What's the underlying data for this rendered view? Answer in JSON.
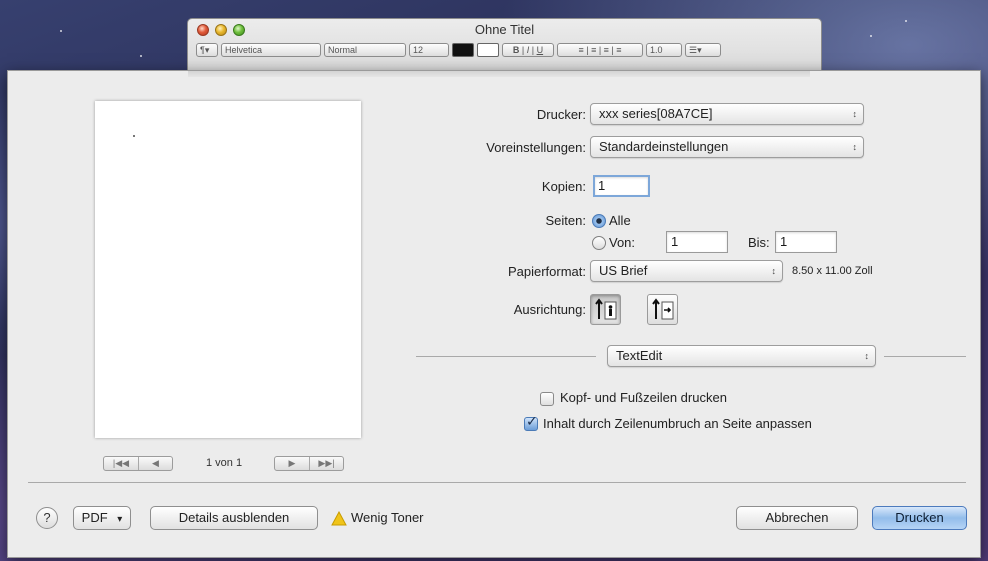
{
  "document": {
    "title": "Ohne Titel",
    "toolbar": {
      "paragraph": "¶▾",
      "font": "Helvetica",
      "style": "Normal",
      "size": "12",
      "line_spacing": "1.0",
      "list": "☰▾"
    }
  },
  "preview": {
    "page_indicator": "1 von 1",
    "first_page": "|◀◀",
    "prev_page": "◀",
    "next_page": "▶",
    "last_page": "▶▶|"
  },
  "printer": {
    "label": "Drucker:",
    "value": "xxx series[08A7CE]"
  },
  "presets": {
    "label": "Voreinstellungen:",
    "value": "Standardeinstellungen"
  },
  "copies": {
    "label": "Kopien:",
    "value": "1"
  },
  "pages": {
    "label": "Seiten:",
    "all_label": "Alle",
    "from_label": "Von:",
    "from_value": "1",
    "to_label": "Bis:",
    "to_value": "1",
    "selected": "Alle"
  },
  "paper": {
    "label": "Papierformat:",
    "value": "US Brief",
    "size_text": "8.50 x 11.00 Zoll"
  },
  "orientation": {
    "label": "Ausrichtung:",
    "selected": "portrait"
  },
  "app_section": {
    "value": "TextEdit"
  },
  "options": {
    "header_footer": {
      "label": "Kopf- und Fußzeilen drucken",
      "checked": false
    },
    "rewrap": {
      "label": "Inhalt durch Zeilenumbruch an Seite anpassen",
      "checked": true
    }
  },
  "footer": {
    "help": "?",
    "pdf": "PDF",
    "pdf_arrow": "▾",
    "details": "Details ausblenden",
    "warning": "Wenig Toner",
    "cancel": "Abbrechen",
    "print": "Drucken"
  },
  "colors": {
    "accent": "#6c9ed8",
    "default_button": "#93bdea",
    "warning": "#f0c419"
  }
}
